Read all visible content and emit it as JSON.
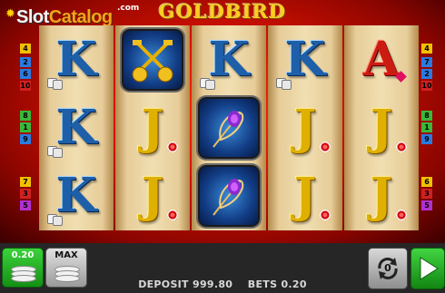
{
  "game": {
    "title": "GOLDBIRD"
  },
  "logo": {
    "brand_part1": "Slot",
    "brand_part2": "Catalog",
    "domain": ".com"
  },
  "colors": {
    "frame_red": "#d01000",
    "reel_beige": "#f1dfb2",
    "button_green": "#2ab32a",
    "button_gray": "#bdbdbd",
    "bottom_bar": "#262626"
  },
  "reels": [
    [
      {
        "symbol": "K",
        "extra": "dice"
      },
      {
        "symbol": "K",
        "extra": "dice"
      },
      {
        "symbol": "K",
        "extra": "dice"
      }
    ],
    [
      {
        "symbol": "keys",
        "icon": "golden-keys-icon"
      },
      {
        "symbol": "J",
        "extra": "chip"
      },
      {
        "symbol": "J",
        "extra": "chip"
      }
    ],
    [
      {
        "symbol": "K",
        "extra": "dice"
      },
      {
        "symbol": "feather",
        "icon": "peacock-feather-icon"
      },
      {
        "symbol": "feather",
        "icon": "peacock-feather-icon"
      }
    ],
    [
      {
        "symbol": "K",
        "extra": "dice"
      },
      {
        "symbol": "J",
        "extra": "chip"
      },
      {
        "symbol": "J",
        "extra": "chip"
      }
    ],
    [
      {
        "symbol": "A",
        "extra": "gem"
      },
      {
        "symbol": "J",
        "extra": "chip"
      },
      {
        "symbol": "J",
        "extra": "chip"
      }
    ]
  ],
  "paylines": {
    "left": [
      "4",
      "2",
      "6",
      "10",
      "8",
      "1",
      "9",
      "7",
      "3",
      "5"
    ],
    "right": [
      "4",
      "7",
      "2",
      "10",
      "8",
      "1",
      "9",
      "6",
      "3",
      "5"
    ]
  },
  "controls": {
    "bet_stack_value": "0.20",
    "max_label": "MAX",
    "deposit_label": "DEPOSIT",
    "deposit_value": "999.80",
    "bets_label": "BETS",
    "bets_value": "0.20",
    "autoplay_count": "0"
  }
}
